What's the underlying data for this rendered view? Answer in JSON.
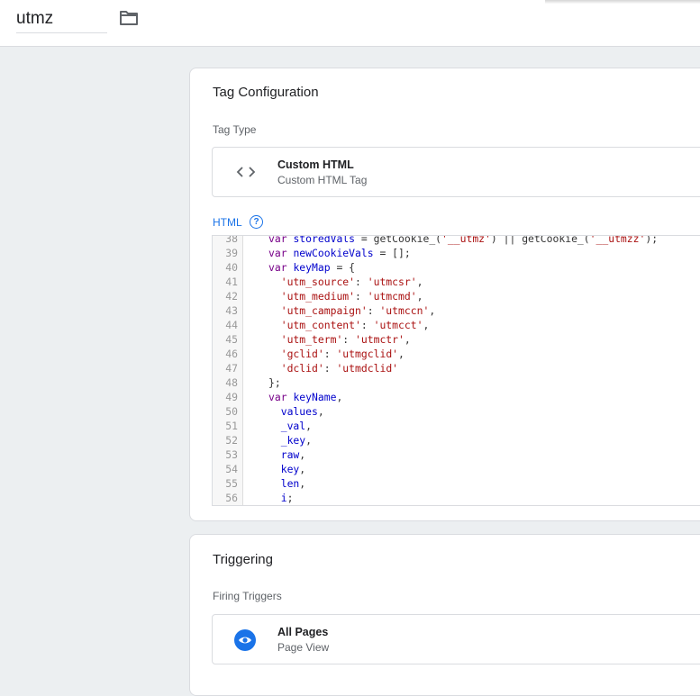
{
  "header": {
    "tag_name": "utmz",
    "folder_icon": "folder-icon"
  },
  "tag_configuration": {
    "title": "Tag Configuration",
    "tag_type_label": "Tag Type",
    "tag_type": {
      "icon": "code-brackets-icon",
      "name": "Custom HTML",
      "description": "Custom HTML Tag"
    },
    "html_label": "HTML",
    "help_icon": "help-circle-icon",
    "code_lines": [
      {
        "n": "38",
        "text": "var storedVals = getCookie_('__utmz') || getCookie_('__utmzz');"
      },
      {
        "n": "39",
        "text": "var newCookieVals = [];"
      },
      {
        "n": "40",
        "text": "var keyMap = {"
      },
      {
        "n": "41",
        "text": "  'utm_source': 'utmcsr',"
      },
      {
        "n": "42",
        "text": "  'utm_medium': 'utmcmd',"
      },
      {
        "n": "43",
        "text": "  'utm_campaign': 'utmccn',"
      },
      {
        "n": "44",
        "text": "  'utm_content': 'utmcct',"
      },
      {
        "n": "45",
        "text": "  'utm_term': 'utmctr',"
      },
      {
        "n": "46",
        "text": "  'gclid': 'utmgclid',"
      },
      {
        "n": "47",
        "text": "  'dclid': 'utmdclid'"
      },
      {
        "n": "48",
        "text": "};"
      },
      {
        "n": "49",
        "text": "var keyName,"
      },
      {
        "n": "50",
        "text": "  values,"
      },
      {
        "n": "51",
        "text": "  _val,"
      },
      {
        "n": "52",
        "text": "  _key,"
      },
      {
        "n": "53",
        "text": "  raw,"
      },
      {
        "n": "54",
        "text": "  key,"
      },
      {
        "n": "55",
        "text": "  len,"
      },
      {
        "n": "56",
        "text": "  i;"
      }
    ]
  },
  "triggering": {
    "title": "Triggering",
    "firing_triggers_label": "Firing Triggers",
    "trigger": {
      "icon": "eye-icon",
      "name": "All Pages",
      "description": "Page View",
      "icon_color": "#1a73e8"
    }
  }
}
